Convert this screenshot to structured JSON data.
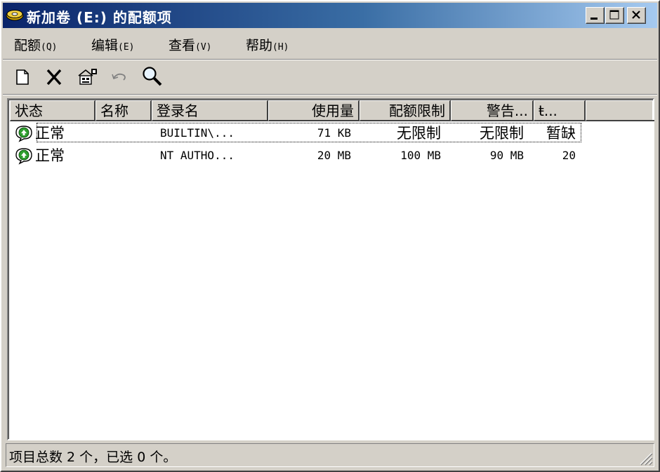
{
  "window": {
    "title": "新加卷 (E:) 的配额项",
    "minimize_label": "_",
    "maximize_label": "□",
    "close_label": "×"
  },
  "menu": [
    {
      "label": "配额",
      "accel": "(Q)"
    },
    {
      "label": "编辑",
      "accel": "(E)"
    },
    {
      "label": "查看",
      "accel": "(V)"
    },
    {
      "label": "帮助",
      "accel": "(H)"
    }
  ],
  "toolbar": {
    "icons": [
      "new-quota-icon",
      "delete-icon",
      "properties-icon",
      "undo-icon",
      "find-icon"
    ]
  },
  "list": {
    "columns": [
      "状态",
      "名称",
      "登录名",
      "使用量",
      "配额限制",
      "警告...",
      "ŧ..."
    ],
    "rows": [
      {
        "status": "正常",
        "name": "",
        "login": "BUILTIN\\...",
        "used": "71 KB",
        "limit": "无限制",
        "warning": "无限制",
        "percent": "暂缺"
      },
      {
        "status": "正常",
        "name": "",
        "login": "NT AUTHO...",
        "used": "20 MB",
        "limit": "100 MB",
        "warning": "90 MB",
        "percent": "20"
      }
    ]
  },
  "statusbar": {
    "text": "项目总数 2 个，已选 0 个。"
  },
  "colors": {
    "title_start": "#0a246a",
    "title_end": "#a6caf0",
    "face": "#d4d0c8",
    "status_icon_green": "#2f9e2f"
  }
}
